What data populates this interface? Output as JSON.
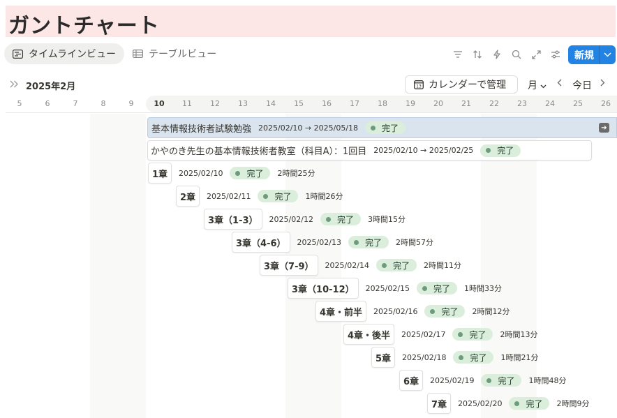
{
  "page": {
    "title": "ガントチャート"
  },
  "views": [
    {
      "label": "タイムラインビュー",
      "icon": "timeline-icon",
      "active": true
    },
    {
      "label": "テーブルビュー",
      "icon": "table-icon",
      "active": false
    }
  ],
  "toolbar": {
    "icons": [
      "filter-icon",
      "sort-icon",
      "automation-icon",
      "search-icon",
      "expand-icon",
      "settings-icon"
    ],
    "new_label": "新規"
  },
  "timeline": {
    "month_label": "2025年2月",
    "calendar_button": "カレンダーで管理",
    "scale": "月",
    "today": "今日",
    "days": [
      "5",
      "6",
      "7",
      "8",
      "9",
      "10",
      "11",
      "12",
      "13",
      "14",
      "15",
      "16",
      "17",
      "18",
      "19",
      "20",
      "21",
      "22",
      "23",
      "24",
      "25",
      "26"
    ],
    "today_day": "10"
  },
  "tasks": {
    "parent": {
      "title": "基本情報技術者試験勉強",
      "range": "2025/02/10 → 2025/05/18",
      "status": "完了"
    },
    "sub": {
      "title": "かやのき先生の基本情報技術者教室（科目A）：1回目",
      "range": "2025/02/10 → 2025/02/25",
      "status": "完了"
    },
    "rows": [
      {
        "title": "1章",
        "date": "2025/02/10",
        "status": "完了",
        "duration": "2時間25分"
      },
      {
        "title": "2章",
        "date": "2025/02/11",
        "status": "完了",
        "duration": "1時間26分"
      },
      {
        "title": "3章（1-3）",
        "date": "2025/02/12",
        "status": "完了",
        "duration": "3時間15分"
      },
      {
        "title": "3章（4-6）",
        "date": "2025/02/13",
        "status": "完了",
        "duration": "2時間57分"
      },
      {
        "title": "3章（7-9）",
        "date": "2025/02/14",
        "status": "完了",
        "duration": "2時間11分"
      },
      {
        "title": "3章（10-12）",
        "date": "2025/02/15",
        "status": "完了",
        "duration": "1時間33分"
      },
      {
        "title": "4章・前半",
        "date": "2025/02/16",
        "status": "完了",
        "duration": "2時間12分"
      },
      {
        "title": "4章・後半",
        "date": "2025/02/17",
        "status": "完了",
        "duration": "2時間13分"
      },
      {
        "title": "5章",
        "date": "2025/02/18",
        "status": "完了",
        "duration": "1時間21分"
      },
      {
        "title": "6章",
        "date": "2025/02/19",
        "status": "完了",
        "duration": "1時間48分"
      },
      {
        "title": "7章",
        "date": "2025/02/20",
        "status": "完了",
        "duration": "2時間9分"
      }
    ]
  }
}
